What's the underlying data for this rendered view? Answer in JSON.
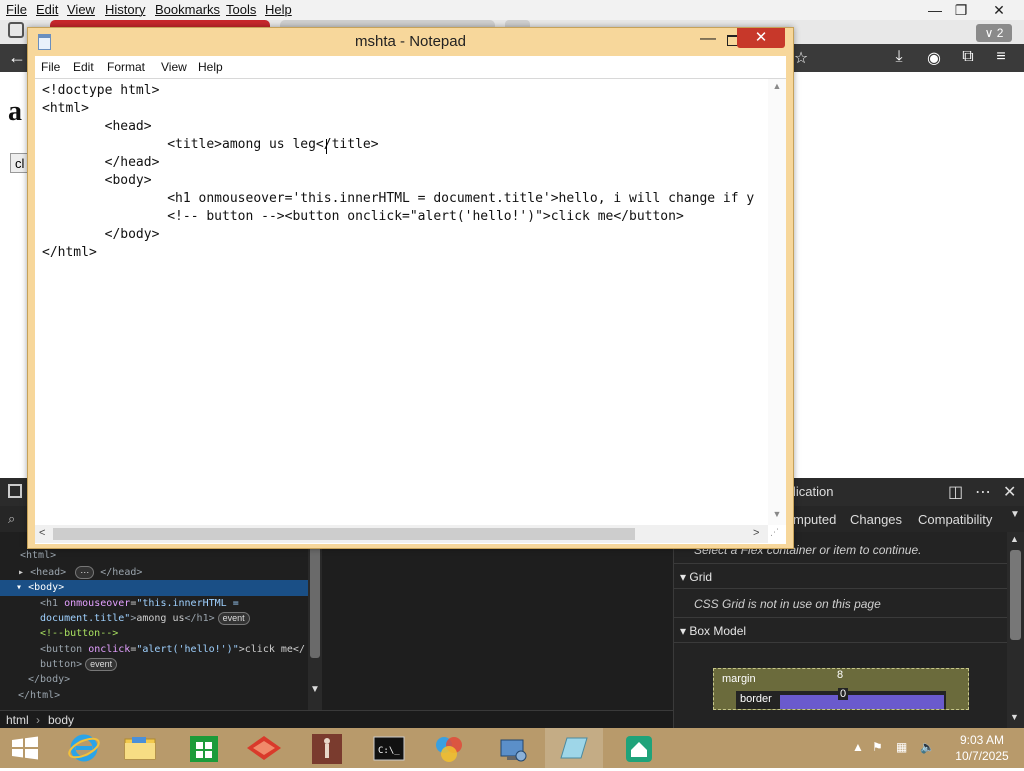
{
  "browser": {
    "menu": [
      "File",
      "Edit",
      "View",
      "History",
      "Bookmarks",
      "Tools",
      "Help"
    ],
    "window_controls": {
      "minimize": "—",
      "restore": "❐",
      "close": "✕"
    },
    "tab_count": "∨ 2",
    "page": {
      "heading_partial": "a",
      "button_partial": "cl"
    }
  },
  "devtools": {
    "tabs_right": [
      "lication"
    ],
    "sub_tabs": [
      "mputed",
      "Changes",
      "Compatibility"
    ],
    "dom": {
      "lines": {
        "html_open": "<html>",
        "head": "<head>",
        "head_close": "</head>",
        "body_open": "<body>",
        "h1_attr": "onmouseover",
        "h1_val1": "\"this.innerHTML =",
        "h1_val2": "document.title\"",
        "h1_text": "among us",
        "h1_close": "</h1>",
        "comment": "<!--button-->",
        "btn_open": "<button",
        "btn_attr": "onclick",
        "btn_val": "\"alert('hello!')\"",
        "btn_text": ">click me</",
        "btn_close": "button>",
        "body_close": "</body>",
        "html_close": "</html>"
      },
      "event_badge": "event",
      "breadcrumb": [
        "html",
        "body"
      ]
    },
    "middle": {
      "brace": "}"
    },
    "right_panel": {
      "flex_msg": "Select a Flex container or item to continue.",
      "grid_header": "Grid",
      "grid_msg": "CSS Grid is not in use on this page",
      "box_header": "Box Model",
      "box": {
        "margin_label": "margin",
        "margin_value": "8",
        "border_label": "border",
        "border_value": "0"
      }
    }
  },
  "notepad": {
    "title": "mshta - Notepad",
    "menu": [
      "File",
      "Edit",
      "Format",
      "View",
      "Help"
    ],
    "code_lines": [
      "<!doctype html>",
      "<html>",
      "        <head>",
      "                <title>among us leg</title>",
      "        </head>",
      "        <body>",
      "                <h1 onmouseover='this.innerHTML = document.title'>hello, i will change if y",
      "                <!-- button --><button onclick=\"alert('hello!')\">click me</button>",
      "        </body>",
      "</html>"
    ]
  },
  "taskbar": {
    "items": [
      "start",
      "internet-explorer",
      "file-explorer",
      "store",
      "app-red",
      "app-figure",
      "command-prompt",
      "app-colorful",
      "remote-desktop",
      "app-blue",
      "app-green"
    ],
    "time": "9:03 AM",
    "date": "10/7/2025"
  }
}
